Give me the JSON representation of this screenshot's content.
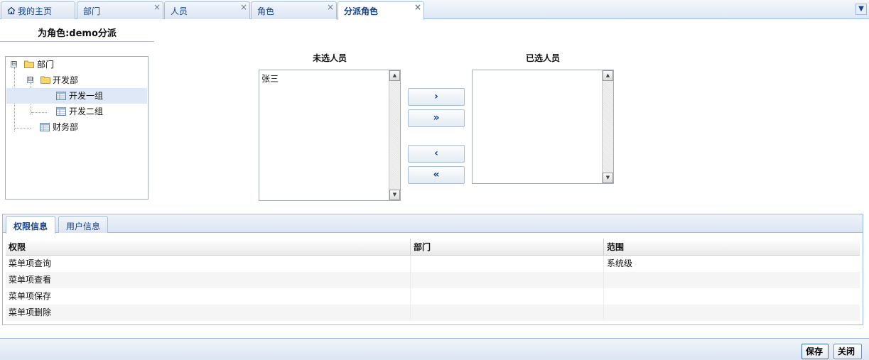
{
  "tabs": [
    {
      "label": "我的主页",
      "closable": false,
      "active": false
    },
    {
      "label": "部门",
      "closable": true,
      "active": false
    },
    {
      "label": "人员",
      "closable": true,
      "active": false
    },
    {
      "label": "角色",
      "closable": true,
      "active": false
    },
    {
      "label": "分派角色",
      "closable": true,
      "active": true
    }
  ],
  "close_glyph": "×",
  "tabstrip_menu_glyph": "▼",
  "assign": {
    "title": "为角色:demo分派"
  },
  "tree": {
    "nodes": [
      {
        "label": "部门",
        "icon": "folder-icon",
        "toggle": "⊟"
      },
      {
        "label": "开发部",
        "icon": "folder-icon",
        "toggle": "⊟"
      },
      {
        "label": "开发一组",
        "icon": "leaf-icon",
        "selected": true
      },
      {
        "label": "开发二组",
        "icon": "leaf-icon"
      },
      {
        "label": "财务部",
        "icon": "leaf-icon"
      }
    ]
  },
  "unselected": {
    "title": "未选人员",
    "items": [
      "张三"
    ]
  },
  "selected": {
    "title": "已选人员",
    "items": []
  },
  "move_buttons": {
    "add": "›",
    "add_all": "»",
    "remove": "‹",
    "remove_all": "«"
  },
  "bottom_tabs": [
    {
      "label": "权限信息",
      "active": true
    },
    {
      "label": "用户信息",
      "active": false
    }
  ],
  "grid": {
    "columns": [
      "权限",
      "部门",
      "范围"
    ],
    "rows": [
      [
        "菜单项查询",
        "",
        "系统级"
      ],
      [
        "菜单项查看",
        "",
        ""
      ],
      [
        "菜单项保存",
        "",
        ""
      ],
      [
        "菜单项删除",
        "",
        ""
      ]
    ]
  },
  "footer": {
    "save": "保存",
    "close": "关闭"
  },
  "colors": {
    "accent": "#15428b",
    "border": "#99bbe8",
    "selected_row": "#dfe8f6"
  }
}
